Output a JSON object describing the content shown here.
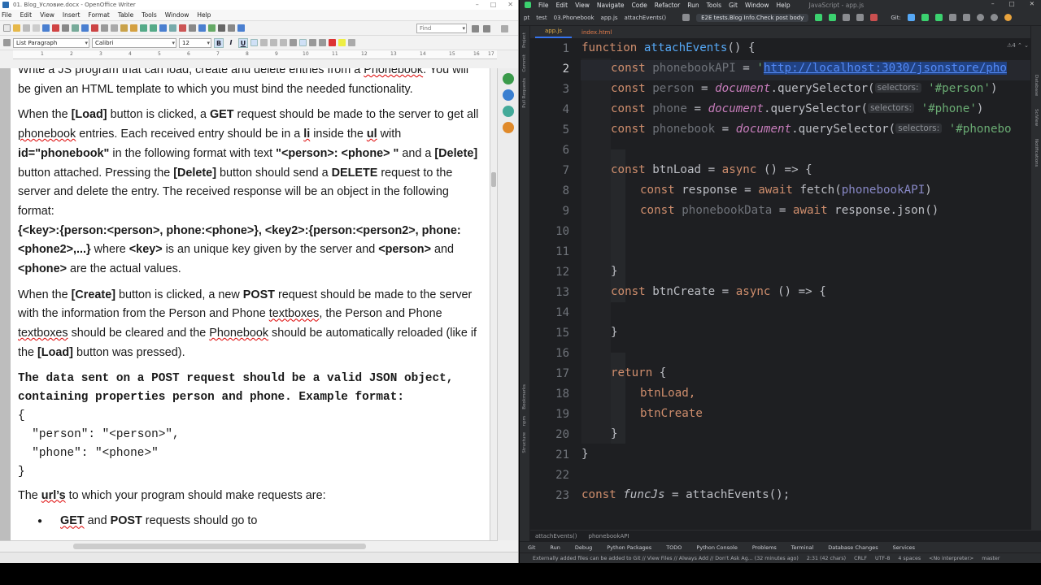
{
  "writer": {
    "title": "01. Blog_Условие.docx - OpenOffice Writer",
    "menu": [
      "File",
      "Edit",
      "View",
      "Insert",
      "Format",
      "Table",
      "Tools",
      "Window",
      "Help"
    ],
    "find_placeholder": "Find",
    "style": "List Paragraph",
    "font": "Calibri",
    "size": "12",
    "format_buttons": [
      "B",
      "I",
      "U"
    ],
    "ruler": [
      "1",
      "2",
      "3",
      "4",
      "5",
      "6",
      "7",
      "8",
      "9",
      "10",
      "11",
      "12",
      "13",
      "14",
      "15",
      "16",
      "17"
    ],
    "doc": {
      "p0": [
        "Write a JS program that can load, create and delete entries from a ",
        "Phonebook",
        ". You will be given an HTML template to which you must bind the needed functionality."
      ],
      "p1": {
        "a1": "When the ",
        "a2": "[Load]",
        "a3": " button is clicked, a ",
        "a4": "GET",
        "a5": " request should be made to the server to get all ",
        "a6": "phonebook",
        "a7": " entries. Each  received entry should be in a ",
        "a8": "li",
        "a9": " inside the ",
        "a10": "ul",
        "a11": " with ",
        "a12": "id=\"phonebook\"",
        "a13": " in the following format with text ",
        "a14": "\"<person>: <phone> \"",
        "a15": " and a ",
        "a16": "[Delete]",
        "a17": " button attached. Pressing the ",
        "a18": "[Delete]",
        "a19": " button should send a ",
        "a20": "DELETE",
        "a21": " request to the server and delete the entry. The received response will be an object in the following format:"
      },
      "p1b": {
        "a1": "{<key>:{person:<person>, phone:<phone>}, <key2>:{person:<person2>, phone:<phone2>,...}",
        "a2": " where ",
        "a3": "<key>",
        "a4": " is an unique key given by the server and ",
        "a5": "<person>",
        "a6": " and ",
        "a7": "<phone>",
        "a8": " are the actual values."
      },
      "p2": {
        "a1": "When the ",
        "a2": "[Create]",
        "a3": " button is clicked, a new ",
        "a4": "POST",
        "a5": " request should be made to the server with the information from the Person and Phone ",
        "a6": "textboxes",
        "a7": ", the Person and Phone ",
        "a8": "textboxes",
        "a9": " should be cleared and the ",
        "a10": "Phonebook",
        "a11": " should be automatically reloaded (like if the ",
        "a12": "[Load]",
        "a13": " button was pressed)."
      },
      "p3": "The data sent on a POST request should be a valid JSON object, containing properties person and phone. Example format:",
      "json": "{\n  \"person\": \"<person>\",\n  \"phone\": \"<phone>\"\n}",
      "p4": {
        "a1": "The ",
        "a2": "url’s",
        "a3": " to which your program should make requests are:"
      },
      "bullet": {
        "a1": "GET",
        "a2": " and ",
        "a3": "POST",
        "a4": " requests should go to"
      }
    }
  },
  "ide": {
    "title": "JavaScript - app.js",
    "menu": [
      "File",
      "Edit",
      "View",
      "Navigate",
      "Code",
      "Refactor",
      "Run",
      "Tools",
      "Git",
      "Window",
      "Help"
    ],
    "breadcrumb_bar": [
      "pt",
      "test",
      "03.Phonebook",
      "app.js",
      "attachEvents()"
    ],
    "run_config": "E2E tests.Blog Info.Check post body",
    "git_label": "Git:",
    "tabs": [
      "app.js",
      "index.html"
    ],
    "left_tools": [
      "Project",
      "Commit",
      "Pull Requests",
      "Bookmarks",
      "npm",
      "Structure"
    ],
    "right_tools": [
      "Database",
      "SciView",
      "Notifications"
    ],
    "inspection": "⚠4 ⌃ ⌄",
    "code_breadcrumb": [
      "attachEvents()",
      "phonebookAPI"
    ],
    "tool_windows": [
      "Git",
      "Run",
      "Debug",
      "Python Packages",
      "TODO",
      "Python Console",
      "Problems",
      "Terminal",
      "Database Changes",
      "Services"
    ],
    "status": {
      "message": "Externally added files can be added to Git // View Files // Always Add // Don't Ask Ag... (32 minutes ago)",
      "position": "2:31 (42 chars)",
      "eol": "CRLF",
      "encoding": "UTF-8",
      "indent": "4 spaces",
      "interpreter": "<No interpreter>",
      "branch": "master"
    },
    "code": {
      "l1": {
        "kw": "function ",
        "fn": "attachEvents",
        "rest": "() {"
      },
      "l2": {
        "kw": "const ",
        "var": "phonebookAPI",
        "eq": " = ",
        "q": "'",
        "url": "http://localhost:3030/jsonstore/pho"
      },
      "l3": {
        "kw": "const ",
        "var": "person",
        "eq": " = ",
        "glob": "document",
        "m": ".querySelector(",
        "hint": "selectors:",
        "str": "'#person'",
        "end": ")"
      },
      "l4": {
        "kw": "const ",
        "var": "phone",
        "eq": " = ",
        "glob": "document",
        "m": ".querySelector(",
        "hint": "selectors:",
        "str": "'#phone'",
        "end": ")"
      },
      "l5": {
        "kw": "const ",
        "var": "phonebook",
        "eq": " = ",
        "glob": "document",
        "m": ".querySelector(",
        "hint": "selectors:",
        "str": "'#phonebo"
      },
      "l7": {
        "kw": "const ",
        "var": "btnLoad",
        "eq": " = ",
        "kw2": "async",
        "rest": " () => {"
      },
      "l8": {
        "kw": "const ",
        "var": "response",
        "eq": " = ",
        "kw2": "await ",
        "fn": "fetch",
        "p": "(",
        "arg": "phonebookAPI",
        "end": ")"
      },
      "l9": {
        "kw": "const ",
        "var": "phonebookData",
        "eq": " = ",
        "kw2": "await ",
        "rest": "response.json()"
      },
      "l12": "}",
      "l13": {
        "kw": "const ",
        "var": "btnCreate",
        "eq": " = ",
        "kw2": "async",
        "rest": " () => {"
      },
      "l15": "}",
      "l17": {
        "kw": "return ",
        "rest": "{"
      },
      "l18": "btnLoad,",
      "l19": "btnCreate",
      "l20": "}",
      "l21": "}",
      "l23": {
        "kw": "const ",
        "var": "funcJs",
        "eq": " = ",
        "fn": "attachEvents",
        "rest": "();"
      }
    },
    "line_numbers": [
      "1",
      "2",
      "3",
      "4",
      "5",
      "6",
      "7",
      "8",
      "9",
      "10",
      "11",
      "12",
      "13",
      "14",
      "15",
      "16",
      "17",
      "18",
      "19",
      "20",
      "21",
      "22",
      "23"
    ]
  },
  "colors": {
    "ide_bg": "#1e1f22",
    "keyword": "#cf8e6d",
    "function": "#56a8f5",
    "string": "#6aab73",
    "global": "#c77dbb",
    "writer_page": "#ffffff"
  }
}
